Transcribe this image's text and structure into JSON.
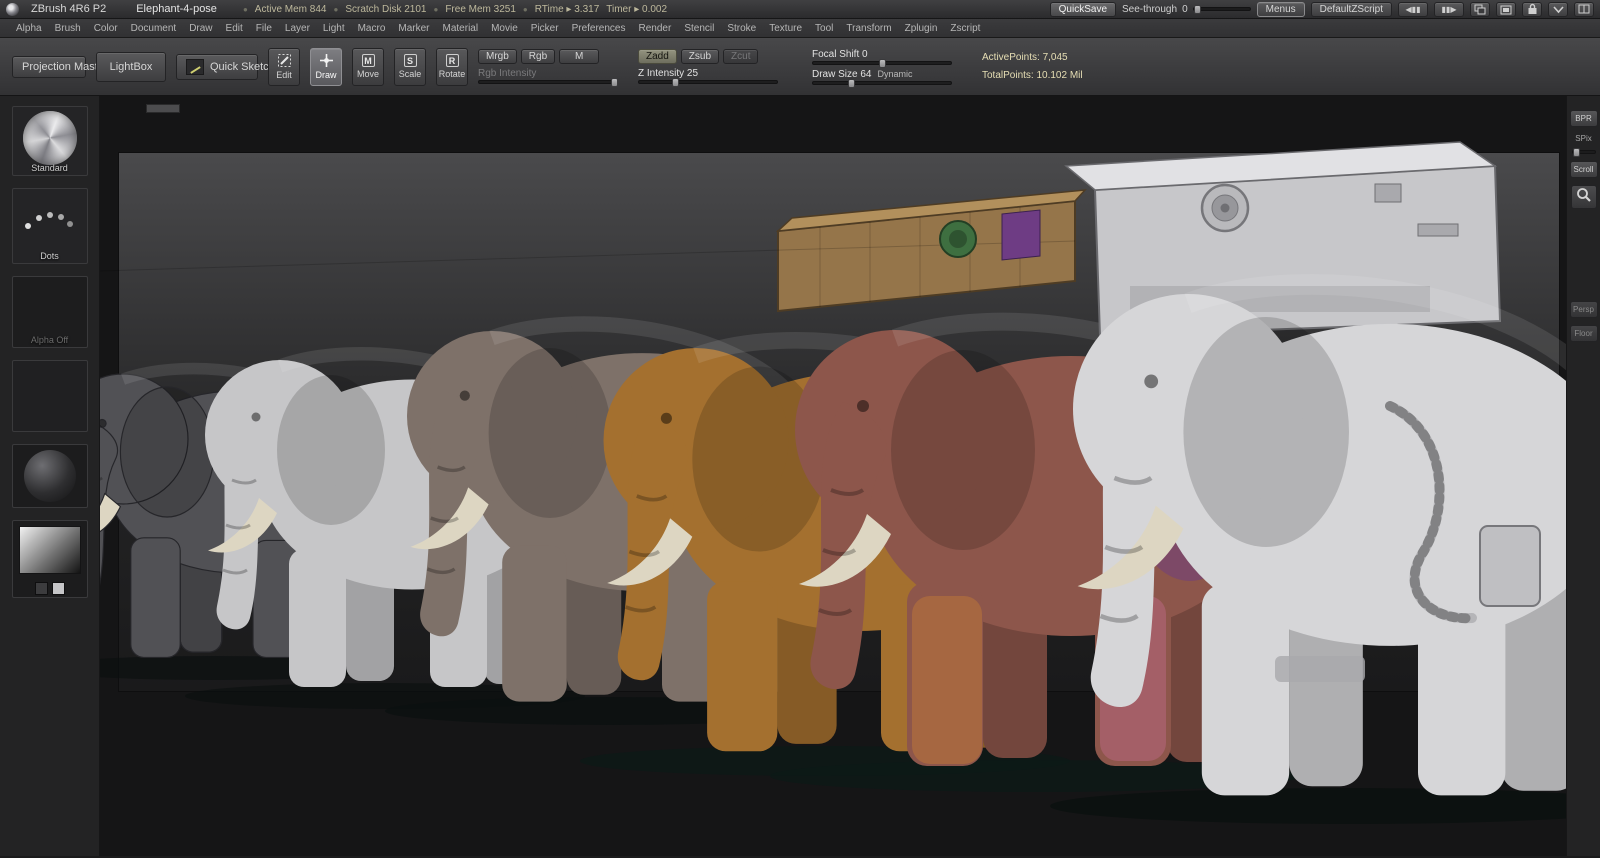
{
  "title_bar": {
    "app_title": "ZBrush 4R6 P2",
    "document_title": "Elephant-4-pose",
    "separator": "●",
    "stats": [
      "Active Mem 844",
      "Scratch Disk 2101",
      "Free Mem 3251",
      "RTime ▸ 3.317",
      "Timer ▸ 0.002"
    ],
    "quicksave": "QuickSave",
    "see_through_label": "See-through",
    "see_through_value": "0",
    "menus": "Menus",
    "default_zscript": "DefaultZScript",
    "scroll_left_icon": "◀▮▮",
    "scroll_right_icon": "▮▮▶"
  },
  "menu": {
    "items": [
      "Alpha",
      "Brush",
      "Color",
      "Document",
      "Draw",
      "Edit",
      "File",
      "Layer",
      "Light",
      "Macro",
      "Marker",
      "Material",
      "Movie",
      "Picker",
      "Preferences",
      "Render",
      "Stencil",
      "Stroke",
      "Texture",
      "Tool",
      "Transform",
      "Zplugin",
      "Zscript"
    ]
  },
  "toolbar": {
    "projection_master": "Projection Master",
    "lightbox": "LightBox",
    "quick_sketch": "Quick Sketch",
    "edit": {
      "label": "Edit"
    },
    "draw": {
      "label": "Draw"
    },
    "move": {
      "label": "Move",
      "icon": "M"
    },
    "scale": {
      "label": "Scale",
      "icon": "S"
    },
    "rotate": {
      "label": "Rotate",
      "icon": "R"
    },
    "mrgb": "Mrgb",
    "rgb": "Rgb",
    "m": "M",
    "zadd": "Zadd",
    "zsub": "Zsub",
    "zcut": "Zcut",
    "rgb_intensity": "Rgb Intensity",
    "z_intensity": "Z Intensity 25",
    "focal_shift": "Focal Shift 0",
    "draw_size": "Draw Size 64",
    "dynamic": "Dynamic",
    "active_points": "ActivePoints: 7,045",
    "total_points": "TotalPoints: 10.102 Mil"
  },
  "left_shelf": {
    "brush_label": "Standard",
    "stroke_label": "Dots",
    "alpha_label": "Alpha Off"
  },
  "right_shelf": {
    "bpr": "BPR",
    "spix": "SPix",
    "scroll": "Scroll",
    "persp": "Persp",
    "floor": "Floor"
  },
  "canvas": {
    "stages": [
      {
        "name": "wireframe base mesh",
        "color": "#515155"
      },
      {
        "name": "smooth sculpt",
        "color": "#c6c6c8"
      },
      {
        "name": "detailed sculpt",
        "color": "#7e7169"
      },
      {
        "name": "textured skin",
        "color": "#a4702f"
      },
      {
        "name": "polypainted with gear",
        "color": "#8d564b"
      },
      {
        "name": "astronaut suit",
        "color": "#d6d6d8"
      }
    ],
    "colors": {
      "pack_tan": "#95754a",
      "pack_purple": "#6e3c84",
      "pack_green": "#3e6f40",
      "suit_pack": "#c7c7ca",
      "suit_pack_top": "#e1e1e4",
      "shadow": "#0a100f"
    }
  }
}
